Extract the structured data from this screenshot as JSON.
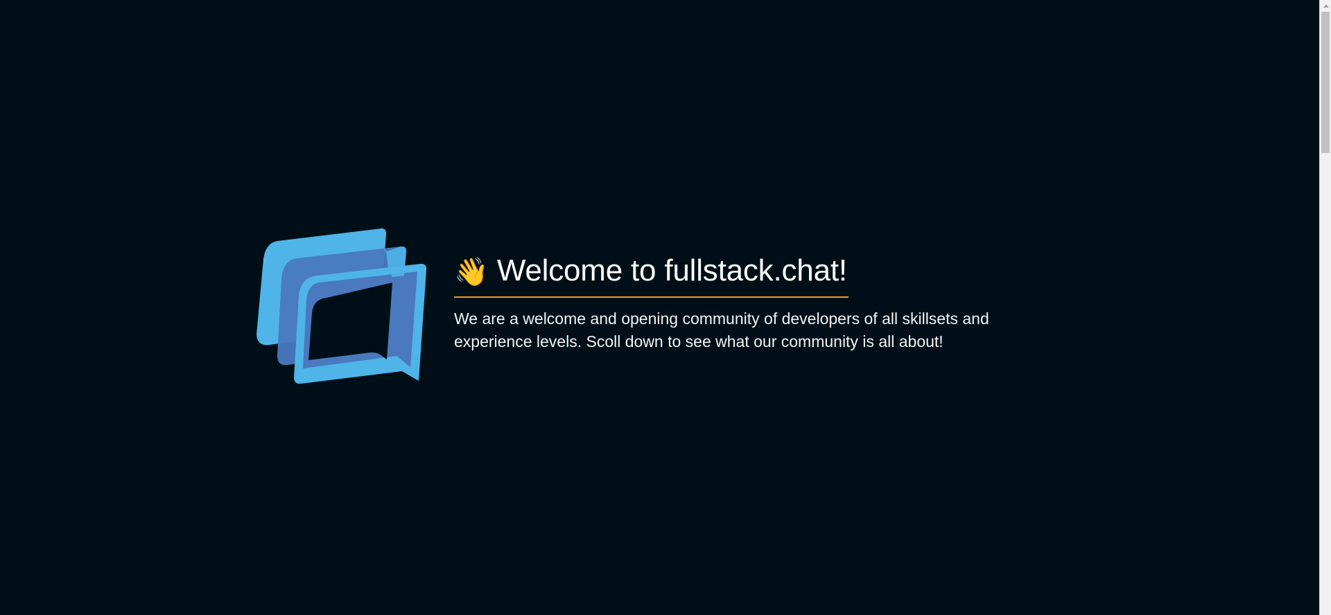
{
  "hero": {
    "logo_icon": "fullstack-chat-logo",
    "wave_icon": "👋",
    "title": "Welcome to fullstack.chat!",
    "intro": "We are a welcome and opening community of developers of all skillsets and experience levels. Scoll down to see what our community is all about!"
  },
  "colors": {
    "background": "#000f17",
    "accent_underline": "#f59a23",
    "logo_light": "#4fb4e8",
    "logo_overlap": "#4a79c0"
  }
}
